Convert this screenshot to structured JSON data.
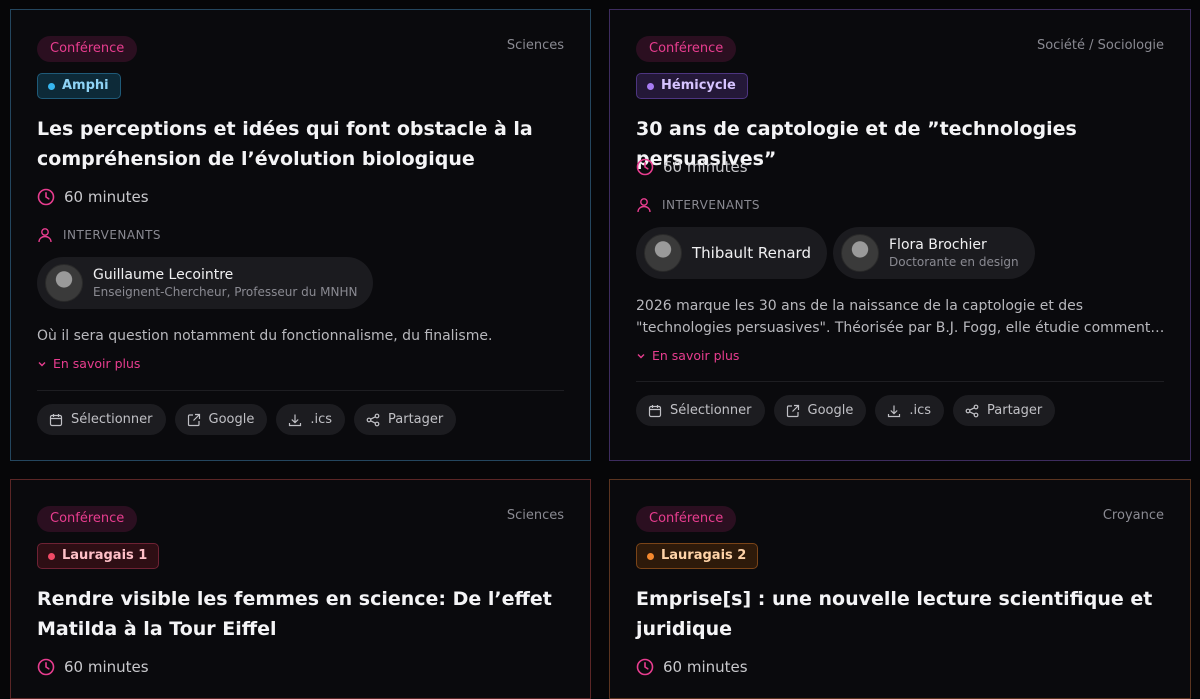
{
  "colors": {
    "accent": "#e83d8f",
    "card_background": "#0a0a0d",
    "page_background": "#060608"
  },
  "common": {
    "speakers_label": "INTERVENANTS",
    "more_label": "En savoir plus",
    "actions": {
      "select": "Sélectionner",
      "google": "Google",
      "ics": ".ics",
      "share": "Partager"
    }
  },
  "cards": [
    {
      "type": "Conférence",
      "category": "Sciences",
      "room": "Amphi",
      "title": "Les perceptions et idées qui font obstacle à la compréhension de l’évolution biologique",
      "duration": "60 minutes",
      "speakers": [
        {
          "name": "Guillaume Lecointre",
          "role": "Enseignent-Chercheur, Professeur du MNHN"
        }
      ],
      "description": "Où il sera question notamment du fonctionnalisme, du finalisme."
    },
    {
      "type": "Conférence",
      "category": "Société / Sociologie",
      "room": "Hémicycle",
      "title": "30 ans de captologie et de ”technologies persuasives”",
      "duration": "60 minutes",
      "speakers": [
        {
          "name": "Thibault Renard",
          "role": ""
        },
        {
          "name": "Flora Brochier",
          "role": "Doctorante en design"
        }
      ],
      "description": "2026 marque les 30 ans de la naissance de la captologie et des \"technologies persuasives\". Théorisée par B.J. Fogg, elle étudie comment…"
    },
    {
      "type": "Conférence",
      "category": "Sciences",
      "room": "Lauragais 1",
      "title": "Rendre visible les femmes en science: De l’effet Matilda à la Tour Eiffel",
      "duration": "60 minutes"
    },
    {
      "type": "Conférence",
      "category": "Croyance",
      "room": "Lauragais 2",
      "title": "Emprise[s] : une nouvelle lecture scientifique et juridique",
      "duration": "60 minutes"
    }
  ]
}
